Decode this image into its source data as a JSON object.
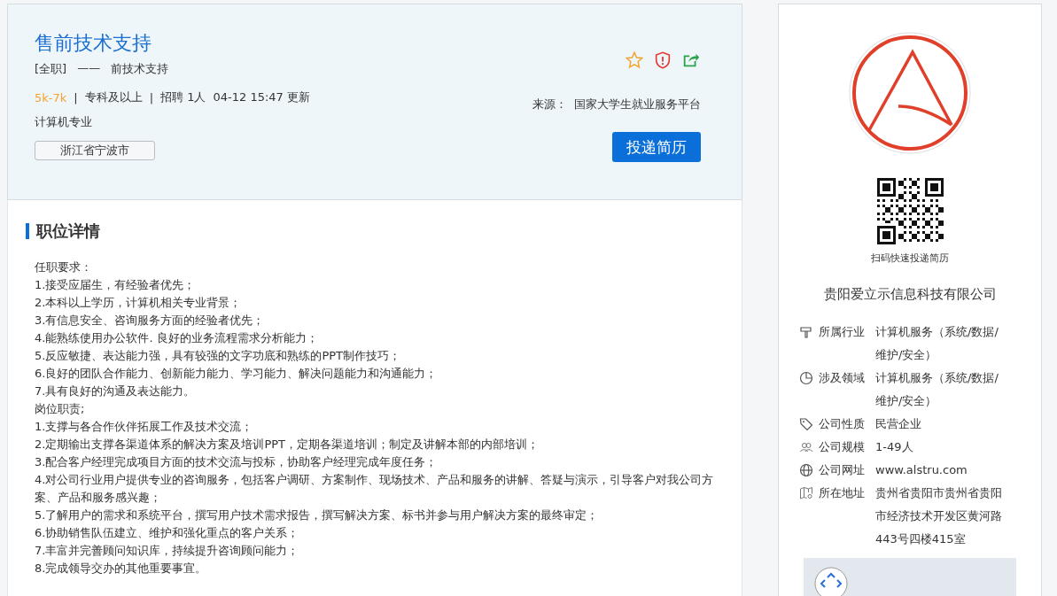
{
  "job": {
    "title": "售前技术支持",
    "employment_type": "[全职]",
    "dash": "——",
    "subtitle": "前技术支持",
    "salary": "5k-7k",
    "divider": "|",
    "education": "专科及以上",
    "headcount": "招聘 1人",
    "updated": "04-12 15:47 更新",
    "major": "计算机专业",
    "location": "浙江省宁波市",
    "source_label": "来源：",
    "source": "国家大学生就业服务平台",
    "apply_button": "投递简历"
  },
  "details": {
    "heading": "职位详情",
    "lines": [
      "任职要求：",
      "1.接受应届生，有经验者优先；",
      "2.本科以上学历，计算机相关专业背景；",
      "3.有信息安全、咨询服务方面的经验者优先；",
      "4.能熟练使用办公软件. 良好的业务流程需求分析能力；",
      "5.反应敏捷、表达能力强，具有较强的文字功底和熟练的PPT制作技巧；",
      "6.良好的团队合作能力、创新能力能力、学习能力、解决问题能力和沟通能力；",
      "7.具有良好的沟通及表达能力。",
      "岗位职责;",
      "1.支撑与各合作伙伴拓展工作及技术交流；",
      "2.定期输出支撑各渠道体系的解决方案及培训PPT，定期各渠道培训；制定及讲解本部的内部培训；",
      "3.配合客户经理完成项目方面的技术交流与投标，协助客户经理完成年度任务；",
      "4.对公司行业用户提供专业的咨询服务，包括客户调研、方案制作、现场技术、产品和服务的讲解、答疑与演示，引导客户对我公司方案、产品和服务感兴趣；",
      "5.了解用户的需求和系统平台，撰写用户技术需求报告，撰写解决方案、标书并参与用户解决方案的最终审定；",
      "6.协助销售队伍建立、维护和强化重点的客户关系；",
      "7.丰富并完善顾问知识库，持续提升咨询顾问能力；",
      "8.完成领导交办的其他重要事宜。"
    ]
  },
  "company": {
    "qr_caption": "扫码快速投递简历",
    "name": "贵阳爱立示信息科技有限公司",
    "info": [
      {
        "kind": "industry",
        "label": "所属行业",
        "value": "计算机服务（系统/数据/维护/安全）"
      },
      {
        "kind": "field",
        "label": "涉及领域",
        "value": "计算机服务（系统/数据/维护/安全）"
      },
      {
        "kind": "nature",
        "label": "公司性质",
        "value": "民营企业"
      },
      {
        "kind": "size",
        "label": "公司规模",
        "value": "1-49人"
      },
      {
        "kind": "website",
        "label": "公司网址",
        "value": "www.alstru.com"
      },
      {
        "kind": "address",
        "label": "所在地址",
        "value": "贵州省贵阳市贵州省贵阳市经济技术开发区黄河路443号四楼415室"
      }
    ]
  }
}
